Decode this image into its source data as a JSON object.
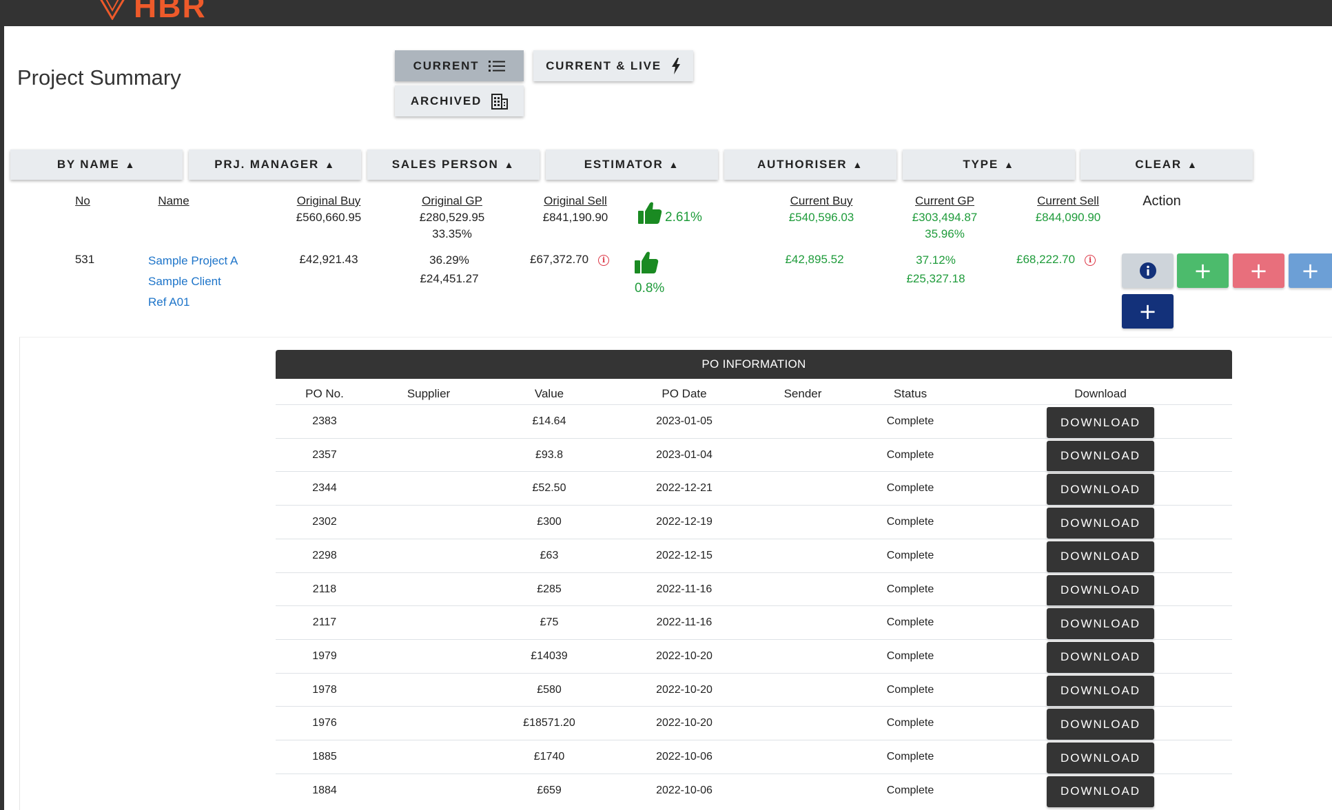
{
  "header": {
    "logo_text": "HBR"
  },
  "page": {
    "title": "Project Summary"
  },
  "view_buttons": {
    "current": "CURRENT",
    "current_live": "CURRENT & LIVE",
    "archived": "ARCHIVED"
  },
  "sort_buttons": [
    "BY NAME",
    "PRJ. MANAGER",
    "SALES PERSON",
    "ESTIMATOR",
    "AUTHORISER",
    "TYPE",
    "CLEAR"
  ],
  "columns": {
    "no": "No",
    "name": "Name",
    "original_buy": "Original Buy",
    "original_gp": "Original GP",
    "original_sell": "Original Sell",
    "current_buy": "Current Buy",
    "current_gp": "Current GP",
    "current_sell": "Current Sell",
    "action": "Action"
  },
  "totals": {
    "original_buy": "£560,660.95",
    "original_gp": "£280,529.95",
    "original_gp_pct": "33.35%",
    "original_sell": "£841,190.90",
    "change_pct": "2.61%",
    "current_buy": "£540,596.03",
    "current_gp": "£303,494.87",
    "current_gp_pct": "35.96%",
    "current_sell": "£844,090.90"
  },
  "project": {
    "no": "531",
    "name": "Sample Project A",
    "client": "Sample Client",
    "ref": "Ref A01",
    "original_buy": "£42,921.43",
    "original_gp_pct": "36.29%",
    "original_gp": "£24,451.27",
    "original_sell": "£67,372.70",
    "change_pct": "0.8%",
    "current_buy": "£42,895.52",
    "current_gp_pct": "37.12%",
    "current_gp": "£25,327.18",
    "current_sell": "£68,222.70"
  },
  "action_colors": {
    "info": "#ced4da",
    "green": "#4cbb6c",
    "red": "#e86f7c",
    "blue": "#6c9fd6",
    "navy": "#13317a"
  },
  "po": {
    "title": "PO INFORMATION",
    "headers": {
      "po_no": "PO No.",
      "supplier": "Supplier",
      "value": "Value",
      "po_date": "PO Date",
      "sender": "Sender",
      "status": "Status",
      "download": "Download"
    },
    "download_label": "DOWNLOAD",
    "rows": [
      {
        "po_no": "2383",
        "supplier": "",
        "value": "£14.64",
        "date": "2023-01-05",
        "sender": "",
        "status": "Complete"
      },
      {
        "po_no": "2357",
        "supplier": "",
        "value": "£93.8",
        "date": "2023-01-04",
        "sender": "",
        "status": "Complete"
      },
      {
        "po_no": "2344",
        "supplier": "",
        "value": "£52.50",
        "date": "2022-12-21",
        "sender": "",
        "status": "Complete"
      },
      {
        "po_no": "2302",
        "supplier": "",
        "value": "£300",
        "date": "2022-12-19",
        "sender": "",
        "status": "Complete"
      },
      {
        "po_no": "2298",
        "supplier": "",
        "value": "£63",
        "date": "2022-12-15",
        "sender": "",
        "status": "Complete"
      },
      {
        "po_no": "2118",
        "supplier": "",
        "value": "£285",
        "date": "2022-11-16",
        "sender": "",
        "status": "Complete"
      },
      {
        "po_no": "2117",
        "supplier": "",
        "value": "£75",
        "date": "2022-11-16",
        "sender": "",
        "status": "Complete"
      },
      {
        "po_no": "1979",
        "supplier": "",
        "value": "£14039",
        "date": "2022-10-20",
        "sender": "",
        "status": "Complete"
      },
      {
        "po_no": "1978",
        "supplier": "",
        "value": "£580",
        "date": "2022-10-20",
        "sender": "",
        "status": "Complete"
      },
      {
        "po_no": "1976",
        "supplier": "",
        "value": "£18571.20",
        "date": "2022-10-20",
        "sender": "",
        "status": "Complete"
      },
      {
        "po_no": "1885",
        "supplier": "",
        "value": "£1740",
        "date": "2022-10-06",
        "sender": "",
        "status": "Complete"
      },
      {
        "po_no": "1884",
        "supplier": "",
        "value": "£659",
        "date": "2022-10-06",
        "sender": "",
        "status": "Complete"
      }
    ]
  }
}
